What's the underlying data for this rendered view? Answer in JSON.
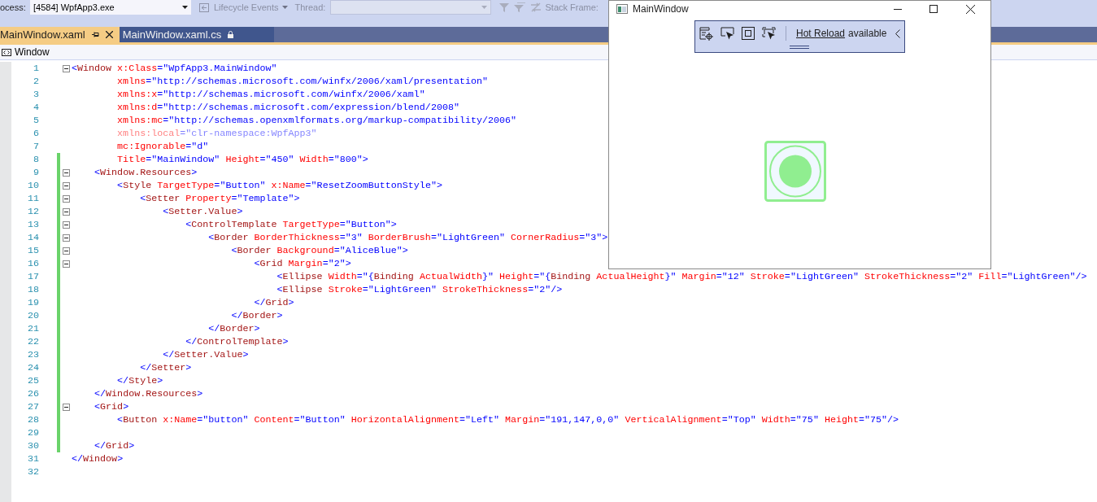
{
  "toolbar": {
    "process_label": "ocess:",
    "process_value": "[4584] WpfApp3.exe",
    "lifecycle_label": "Lifecycle Events",
    "thread_label": "Thread:",
    "thread_dropdown": {
      "disabled": true
    },
    "stack_frame_label": "Stack Frame:"
  },
  "tabs": [
    {
      "label": "MainWindow.xaml",
      "selected": true,
      "locked": false
    },
    {
      "label": "MainWindow.xaml.cs",
      "selected": false,
      "locked": true
    }
  ],
  "navigation_bar": {
    "label": "Window"
  },
  "editor": {
    "lines": [
      {
        "number": "1",
        "collapsible": true,
        "changed": false,
        "dimmed": false,
        "tokens": [
          {
            "kind": "punct",
            "text": "<"
          },
          {
            "kind": "tag",
            "text": "Window"
          },
          {
            "kind": "attr",
            "text": " x:Class"
          },
          {
            "kind": "punct",
            "text": "="
          },
          {
            "kind": "value",
            "text": "\"WpfApp3.MainWindow\""
          }
        ]
      },
      {
        "number": "2",
        "collapsible": false,
        "changed": false,
        "dimmed": false,
        "tokens": [
          {
            "kind": "attr",
            "text": "        xmlns"
          },
          {
            "kind": "punct",
            "text": "="
          },
          {
            "kind": "value",
            "text": "\"http://schemas.microsoft.com/winfx/2006/xaml/presentation\""
          }
        ]
      },
      {
        "number": "3",
        "collapsible": false,
        "changed": false,
        "dimmed": false,
        "tokens": [
          {
            "kind": "attr",
            "text": "        xmlns:x"
          },
          {
            "kind": "punct",
            "text": "="
          },
          {
            "kind": "value",
            "text": "\"http://schemas.microsoft.com/winfx/2006/xaml\""
          }
        ]
      },
      {
        "number": "4",
        "collapsible": false,
        "changed": false,
        "dimmed": false,
        "tokens": [
          {
            "kind": "attr",
            "text": "        xmlns:d"
          },
          {
            "kind": "punct",
            "text": "="
          },
          {
            "kind": "value",
            "text": "\"http://schemas.microsoft.com/expression/blend/2008\""
          }
        ]
      },
      {
        "number": "5",
        "collapsible": false,
        "changed": false,
        "dimmed": false,
        "tokens": [
          {
            "kind": "attr",
            "text": "        xmlns:mc"
          },
          {
            "kind": "punct",
            "text": "="
          },
          {
            "kind": "value",
            "text": "\"http://schemas.openxmlformats.org/markup-compatibility/2006\""
          }
        ]
      },
      {
        "number": "6",
        "collapsible": false,
        "changed": false,
        "dimmed": true,
        "tokens": [
          {
            "kind": "attr",
            "text": "        xmlns:local"
          },
          {
            "kind": "punct",
            "text": "="
          },
          {
            "kind": "value",
            "text": "\"clr-namespace:WpfApp3\""
          }
        ]
      },
      {
        "number": "7",
        "collapsible": false,
        "changed": false,
        "dimmed": false,
        "tokens": [
          {
            "kind": "attr",
            "text": "        mc:Ignorable"
          },
          {
            "kind": "punct",
            "text": "="
          },
          {
            "kind": "value",
            "text": "\"d\""
          }
        ]
      },
      {
        "number": "8",
        "collapsible": false,
        "changed": true,
        "dimmed": false,
        "tokens": [
          {
            "kind": "attr",
            "text": "        Title"
          },
          {
            "kind": "punct",
            "text": "="
          },
          {
            "kind": "value",
            "text": "\"MainWindow\""
          },
          {
            "kind": "attr",
            "text": " Height"
          },
          {
            "kind": "punct",
            "text": "="
          },
          {
            "kind": "value",
            "text": "\"450\""
          },
          {
            "kind": "attr",
            "text": " Width"
          },
          {
            "kind": "punct",
            "text": "="
          },
          {
            "kind": "value",
            "text": "\"800\""
          },
          {
            "kind": "punct",
            "text": ">"
          }
        ]
      },
      {
        "number": "9",
        "collapsible": true,
        "changed": true,
        "dimmed": false,
        "tokens": [
          {
            "kind": "punct",
            "text": "    <"
          },
          {
            "kind": "tag",
            "text": "Window.Resources"
          },
          {
            "kind": "punct",
            "text": ">"
          }
        ]
      },
      {
        "number": "10",
        "collapsible": true,
        "changed": true,
        "dimmed": false,
        "tokens": [
          {
            "kind": "punct",
            "text": "        <"
          },
          {
            "kind": "tag",
            "text": "Style"
          },
          {
            "kind": "attr",
            "text": " TargetType"
          },
          {
            "kind": "punct",
            "text": "="
          },
          {
            "kind": "value",
            "text": "\"Button\""
          },
          {
            "kind": "attr",
            "text": " x:Name"
          },
          {
            "kind": "punct",
            "text": "="
          },
          {
            "kind": "value",
            "text": "\"ResetZoomButtonStyle\""
          },
          {
            "kind": "punct",
            "text": ">"
          }
        ]
      },
      {
        "number": "11",
        "collapsible": true,
        "changed": true,
        "dimmed": false,
        "tokens": [
          {
            "kind": "punct",
            "text": "            <"
          },
          {
            "kind": "tag",
            "text": "Setter"
          },
          {
            "kind": "attr",
            "text": " Property"
          },
          {
            "kind": "punct",
            "text": "="
          },
          {
            "kind": "value",
            "text": "\"Template\""
          },
          {
            "kind": "punct",
            "text": ">"
          }
        ]
      },
      {
        "number": "12",
        "collapsible": true,
        "changed": true,
        "dimmed": false,
        "tokens": [
          {
            "kind": "punct",
            "text": "                <"
          },
          {
            "kind": "tag",
            "text": "Setter.Value"
          },
          {
            "kind": "punct",
            "text": ">"
          }
        ]
      },
      {
        "number": "13",
        "collapsible": true,
        "changed": true,
        "dimmed": false,
        "tokens": [
          {
            "kind": "punct",
            "text": "                    <"
          },
          {
            "kind": "tag",
            "text": "ControlTemplate"
          },
          {
            "kind": "attr",
            "text": " TargetType"
          },
          {
            "kind": "punct",
            "text": "="
          },
          {
            "kind": "value",
            "text": "\"Button\""
          },
          {
            "kind": "punct",
            "text": ">"
          }
        ]
      },
      {
        "number": "14",
        "collapsible": true,
        "changed": true,
        "dimmed": false,
        "tokens": [
          {
            "kind": "punct",
            "text": "                        <"
          },
          {
            "kind": "tag",
            "text": "Border"
          },
          {
            "kind": "attr",
            "text": " BorderThickness"
          },
          {
            "kind": "punct",
            "text": "="
          },
          {
            "kind": "value",
            "text": "\"3\""
          },
          {
            "kind": "attr",
            "text": " BorderBrush"
          },
          {
            "kind": "punct",
            "text": "="
          },
          {
            "kind": "value",
            "text": "\"LightGreen\""
          },
          {
            "kind": "attr",
            "text": " CornerRadius"
          },
          {
            "kind": "punct",
            "text": "="
          },
          {
            "kind": "value",
            "text": "\"3\""
          },
          {
            "kind": "punct",
            "text": ">"
          }
        ]
      },
      {
        "number": "15",
        "collapsible": true,
        "changed": true,
        "dimmed": false,
        "tokens": [
          {
            "kind": "punct",
            "text": "                            <"
          },
          {
            "kind": "tag",
            "text": "Border"
          },
          {
            "kind": "attr",
            "text": " Background"
          },
          {
            "kind": "punct",
            "text": "="
          },
          {
            "kind": "value",
            "text": "\"AliceBlue\""
          },
          {
            "kind": "punct",
            "text": ">"
          }
        ]
      },
      {
        "number": "16",
        "collapsible": true,
        "changed": true,
        "dimmed": false,
        "tokens": [
          {
            "kind": "punct",
            "text": "                                <"
          },
          {
            "kind": "tag",
            "text": "Grid"
          },
          {
            "kind": "attr",
            "text": " Margin"
          },
          {
            "kind": "punct",
            "text": "="
          },
          {
            "kind": "value",
            "text": "\"2\""
          },
          {
            "kind": "punct",
            "text": ">"
          }
        ]
      },
      {
        "number": "17",
        "collapsible": false,
        "changed": true,
        "dimmed": false,
        "tokens": [
          {
            "kind": "punct",
            "text": "                                    <"
          },
          {
            "kind": "tag",
            "text": "Ellipse"
          },
          {
            "kind": "attr",
            "text": " Width"
          },
          {
            "kind": "punct",
            "text": "=\"{"
          },
          {
            "kind": "tag",
            "text": "Binding"
          },
          {
            "kind": "attr",
            "text": " ActualWidth"
          },
          {
            "kind": "punct",
            "text": "}\""
          },
          {
            "kind": "attr",
            "text": " Height"
          },
          {
            "kind": "punct",
            "text": "=\"{"
          },
          {
            "kind": "tag",
            "text": "Binding"
          },
          {
            "kind": "attr",
            "text": " ActualHeight"
          },
          {
            "kind": "punct",
            "text": "}\""
          },
          {
            "kind": "attr",
            "text": " Margin"
          },
          {
            "kind": "punct",
            "text": "="
          },
          {
            "kind": "value",
            "text": "\"12\""
          },
          {
            "kind": "attr",
            "text": " Stroke"
          },
          {
            "kind": "punct",
            "text": "="
          },
          {
            "kind": "value",
            "text": "\"LightGreen\""
          },
          {
            "kind": "attr",
            "text": " StrokeThickness"
          },
          {
            "kind": "punct",
            "text": "="
          },
          {
            "kind": "value",
            "text": "\"2\""
          },
          {
            "kind": "attr",
            "text": " Fill"
          },
          {
            "kind": "punct",
            "text": "="
          },
          {
            "kind": "value",
            "text": "\"LightGreen\""
          },
          {
            "kind": "punct",
            "text": "/>"
          }
        ]
      },
      {
        "number": "18",
        "collapsible": false,
        "changed": true,
        "dimmed": false,
        "tokens": [
          {
            "kind": "punct",
            "text": "                                    <"
          },
          {
            "kind": "tag",
            "text": "Ellipse"
          },
          {
            "kind": "attr",
            "text": " Stroke"
          },
          {
            "kind": "punct",
            "text": "="
          },
          {
            "kind": "value",
            "text": "\"LightGreen\""
          },
          {
            "kind": "attr",
            "text": " StrokeThickness"
          },
          {
            "kind": "punct",
            "text": "="
          },
          {
            "kind": "value",
            "text": "\"2\""
          },
          {
            "kind": "punct",
            "text": "/>"
          }
        ]
      },
      {
        "number": "19",
        "collapsible": false,
        "changed": true,
        "dimmed": false,
        "tokens": [
          {
            "kind": "punct",
            "text": "                                </"
          },
          {
            "kind": "tag",
            "text": "Grid"
          },
          {
            "kind": "punct",
            "text": ">"
          }
        ]
      },
      {
        "number": "20",
        "collapsible": false,
        "changed": true,
        "dimmed": false,
        "tokens": [
          {
            "kind": "punct",
            "text": "                            </"
          },
          {
            "kind": "tag",
            "text": "Border"
          },
          {
            "kind": "punct",
            "text": ">"
          }
        ]
      },
      {
        "number": "21",
        "collapsible": false,
        "changed": true,
        "dimmed": false,
        "tokens": [
          {
            "kind": "punct",
            "text": "                        </"
          },
          {
            "kind": "tag",
            "text": "Border"
          },
          {
            "kind": "punct",
            "text": ">"
          }
        ]
      },
      {
        "number": "22",
        "collapsible": false,
        "changed": true,
        "dimmed": false,
        "tokens": [
          {
            "kind": "punct",
            "text": "                    </"
          },
          {
            "kind": "tag",
            "text": "ControlTemplate"
          },
          {
            "kind": "punct",
            "text": ">"
          }
        ]
      },
      {
        "number": "23",
        "collapsible": false,
        "changed": true,
        "dimmed": false,
        "tokens": [
          {
            "kind": "punct",
            "text": "                </"
          },
          {
            "kind": "tag",
            "text": "Setter.Value"
          },
          {
            "kind": "punct",
            "text": ">"
          }
        ]
      },
      {
        "number": "24",
        "collapsible": false,
        "changed": true,
        "dimmed": false,
        "tokens": [
          {
            "kind": "punct",
            "text": "            </"
          },
          {
            "kind": "tag",
            "text": "Setter"
          },
          {
            "kind": "punct",
            "text": ">"
          }
        ]
      },
      {
        "number": "25",
        "collapsible": false,
        "changed": true,
        "dimmed": false,
        "tokens": [
          {
            "kind": "punct",
            "text": "        </"
          },
          {
            "kind": "tag",
            "text": "Style"
          },
          {
            "kind": "punct",
            "text": ">"
          }
        ]
      },
      {
        "number": "26",
        "collapsible": false,
        "changed": true,
        "dimmed": false,
        "tokens": [
          {
            "kind": "punct",
            "text": "    </"
          },
          {
            "kind": "tag",
            "text": "Window.Resources"
          },
          {
            "kind": "punct",
            "text": ">"
          }
        ]
      },
      {
        "number": "27",
        "collapsible": true,
        "changed": true,
        "dimmed": false,
        "tokens": [
          {
            "kind": "punct",
            "text": "    <"
          },
          {
            "kind": "tag",
            "text": "Grid"
          },
          {
            "kind": "punct",
            "text": ">"
          }
        ]
      },
      {
        "number": "28",
        "collapsible": false,
        "changed": true,
        "dimmed": false,
        "tokens": [
          {
            "kind": "punct",
            "text": "        <"
          },
          {
            "kind": "tag",
            "text": "Button"
          },
          {
            "kind": "attr",
            "text": " x:Name"
          },
          {
            "kind": "punct",
            "text": "="
          },
          {
            "kind": "value",
            "text": "\"button\""
          },
          {
            "kind": "attr",
            "text": " Content"
          },
          {
            "kind": "punct",
            "text": "="
          },
          {
            "kind": "value",
            "text": "\"Button\""
          },
          {
            "kind": "attr",
            "text": " HorizontalAlignment"
          },
          {
            "kind": "punct",
            "text": "="
          },
          {
            "kind": "value",
            "text": "\"Left\""
          },
          {
            "kind": "attr",
            "text": " Margin"
          },
          {
            "kind": "punct",
            "text": "="
          },
          {
            "kind": "value",
            "text": "\"191,147,0,0\""
          },
          {
            "kind": "attr",
            "text": " VerticalAlignment"
          },
          {
            "kind": "punct",
            "text": "="
          },
          {
            "kind": "value",
            "text": "\"Top\""
          },
          {
            "kind": "attr",
            "text": " Width"
          },
          {
            "kind": "punct",
            "text": "="
          },
          {
            "kind": "value",
            "text": "\"75\""
          },
          {
            "kind": "attr",
            "text": " Height"
          },
          {
            "kind": "punct",
            "text": "="
          },
          {
            "kind": "value",
            "text": "\"75\""
          },
          {
            "kind": "punct",
            "text": "/>"
          }
        ]
      },
      {
        "number": "29",
        "collapsible": false,
        "changed": true,
        "dimmed": false
      },
      {
        "number": "30",
        "collapsible": false,
        "changed": true,
        "dimmed": false,
        "tokens": [
          {
            "kind": "punct",
            "text": "    </"
          },
          {
            "kind": "tag",
            "text": "Grid"
          },
          {
            "kind": "punct",
            "text": ">"
          }
        ]
      },
      {
        "number": "31",
        "collapsible": false,
        "changed": false,
        "dimmed": false,
        "tokens": [
          {
            "kind": "punct",
            "text": "</"
          },
          {
            "kind": "tag",
            "text": "Window"
          },
          {
            "kind": "punct",
            "text": ">"
          }
        ]
      },
      {
        "number": "32",
        "collapsible": false,
        "changed": false,
        "dimmed": false
      }
    ]
  },
  "app_window": {
    "title": "MainWindow",
    "hot_reload": {
      "link": "Hot Reload",
      "text": "available"
    }
  }
}
